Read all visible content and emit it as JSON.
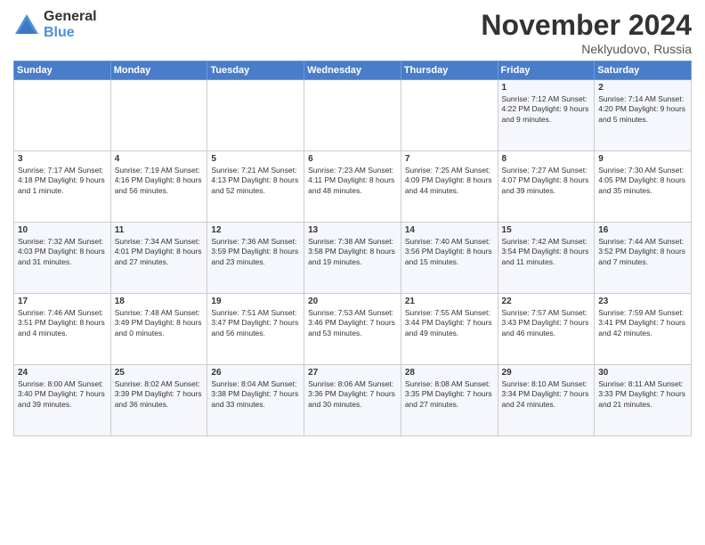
{
  "logo": {
    "general": "General",
    "blue": "Blue"
  },
  "title": {
    "month": "November 2024",
    "location": "Neklyudovo, Russia"
  },
  "weekdays": [
    "Sunday",
    "Monday",
    "Tuesday",
    "Wednesday",
    "Thursday",
    "Friday",
    "Saturday"
  ],
  "weeks": [
    [
      {
        "day": "",
        "info": ""
      },
      {
        "day": "",
        "info": ""
      },
      {
        "day": "",
        "info": ""
      },
      {
        "day": "",
        "info": ""
      },
      {
        "day": "",
        "info": ""
      },
      {
        "day": "1",
        "info": "Sunrise: 7:12 AM\nSunset: 4:22 PM\nDaylight: 9 hours\nand 9 minutes."
      },
      {
        "day": "2",
        "info": "Sunrise: 7:14 AM\nSunset: 4:20 PM\nDaylight: 9 hours\nand 5 minutes."
      }
    ],
    [
      {
        "day": "3",
        "info": "Sunrise: 7:17 AM\nSunset: 4:18 PM\nDaylight: 9 hours\nand 1 minute."
      },
      {
        "day": "4",
        "info": "Sunrise: 7:19 AM\nSunset: 4:16 PM\nDaylight: 8 hours\nand 56 minutes."
      },
      {
        "day": "5",
        "info": "Sunrise: 7:21 AM\nSunset: 4:13 PM\nDaylight: 8 hours\nand 52 minutes."
      },
      {
        "day": "6",
        "info": "Sunrise: 7:23 AM\nSunset: 4:11 PM\nDaylight: 8 hours\nand 48 minutes."
      },
      {
        "day": "7",
        "info": "Sunrise: 7:25 AM\nSunset: 4:09 PM\nDaylight: 8 hours\nand 44 minutes."
      },
      {
        "day": "8",
        "info": "Sunrise: 7:27 AM\nSunset: 4:07 PM\nDaylight: 8 hours\nand 39 minutes."
      },
      {
        "day": "9",
        "info": "Sunrise: 7:30 AM\nSunset: 4:05 PM\nDaylight: 8 hours\nand 35 minutes."
      }
    ],
    [
      {
        "day": "10",
        "info": "Sunrise: 7:32 AM\nSunset: 4:03 PM\nDaylight: 8 hours\nand 31 minutes."
      },
      {
        "day": "11",
        "info": "Sunrise: 7:34 AM\nSunset: 4:01 PM\nDaylight: 8 hours\nand 27 minutes."
      },
      {
        "day": "12",
        "info": "Sunrise: 7:36 AM\nSunset: 3:59 PM\nDaylight: 8 hours\nand 23 minutes."
      },
      {
        "day": "13",
        "info": "Sunrise: 7:38 AM\nSunset: 3:58 PM\nDaylight: 8 hours\nand 19 minutes."
      },
      {
        "day": "14",
        "info": "Sunrise: 7:40 AM\nSunset: 3:56 PM\nDaylight: 8 hours\nand 15 minutes."
      },
      {
        "day": "15",
        "info": "Sunrise: 7:42 AM\nSunset: 3:54 PM\nDaylight: 8 hours\nand 11 minutes."
      },
      {
        "day": "16",
        "info": "Sunrise: 7:44 AM\nSunset: 3:52 PM\nDaylight: 8 hours\nand 7 minutes."
      }
    ],
    [
      {
        "day": "17",
        "info": "Sunrise: 7:46 AM\nSunset: 3:51 PM\nDaylight: 8 hours\nand 4 minutes."
      },
      {
        "day": "18",
        "info": "Sunrise: 7:48 AM\nSunset: 3:49 PM\nDaylight: 8 hours\nand 0 minutes."
      },
      {
        "day": "19",
        "info": "Sunrise: 7:51 AM\nSunset: 3:47 PM\nDaylight: 7 hours\nand 56 minutes."
      },
      {
        "day": "20",
        "info": "Sunrise: 7:53 AM\nSunset: 3:46 PM\nDaylight: 7 hours\nand 53 minutes."
      },
      {
        "day": "21",
        "info": "Sunrise: 7:55 AM\nSunset: 3:44 PM\nDaylight: 7 hours\nand 49 minutes."
      },
      {
        "day": "22",
        "info": "Sunrise: 7:57 AM\nSunset: 3:43 PM\nDaylight: 7 hours\nand 46 minutes."
      },
      {
        "day": "23",
        "info": "Sunrise: 7:59 AM\nSunset: 3:41 PM\nDaylight: 7 hours\nand 42 minutes."
      }
    ],
    [
      {
        "day": "24",
        "info": "Sunrise: 8:00 AM\nSunset: 3:40 PM\nDaylight: 7 hours\nand 39 minutes."
      },
      {
        "day": "25",
        "info": "Sunrise: 8:02 AM\nSunset: 3:39 PM\nDaylight: 7 hours\nand 36 minutes."
      },
      {
        "day": "26",
        "info": "Sunrise: 8:04 AM\nSunset: 3:38 PM\nDaylight: 7 hours\nand 33 minutes."
      },
      {
        "day": "27",
        "info": "Sunrise: 8:06 AM\nSunset: 3:36 PM\nDaylight: 7 hours\nand 30 minutes."
      },
      {
        "day": "28",
        "info": "Sunrise: 8:08 AM\nSunset: 3:35 PM\nDaylight: 7 hours\nand 27 minutes."
      },
      {
        "day": "29",
        "info": "Sunrise: 8:10 AM\nSunset: 3:34 PM\nDaylight: 7 hours\nand 24 minutes."
      },
      {
        "day": "30",
        "info": "Sunrise: 8:11 AM\nSunset: 3:33 PM\nDaylight: 7 hours\nand 21 minutes."
      }
    ]
  ]
}
